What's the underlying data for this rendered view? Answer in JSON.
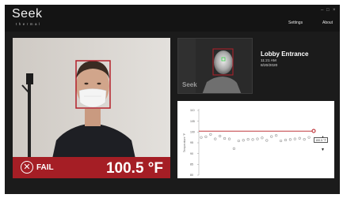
{
  "app": {
    "logo": "Seek",
    "logo_sub": "thermal"
  },
  "nav": {
    "settings": "Settings",
    "about": "About"
  },
  "window": {
    "minimize": "–",
    "maximize": "□",
    "close": "×"
  },
  "status": {
    "result": "FAIL",
    "temperature": "100.5 °F",
    "color": "#a51e25"
  },
  "location": {
    "name": "Lobby Entrance",
    "time": "11:21 AM",
    "date": "8/20/2020"
  },
  "thermal": {
    "watermark": "Seek"
  },
  "chart_data": {
    "type": "scatter",
    "ylabel": "Temperature °F",
    "ylim": [
      80,
      110
    ],
    "yticks": [
      "110",
      "105",
      "100",
      "95",
      "90",
      "85",
      "80"
    ],
    "threshold": 100.4,
    "values": [
      97.5,
      97.8,
      98.9,
      96.8,
      98.1,
      97.0,
      96.8,
      92.3,
      95.9,
      96.2,
      96.6,
      96.5,
      96.8,
      97.3,
      96.1,
      97.9,
      98.4,
      95.9,
      96.3,
      96.5,
      96.8,
      97.1,
      96.6,
      97.5,
      100.5
    ],
    "selected_index": 24,
    "tooltip": "100.5 °F",
    "threshold_color": "#c0393e",
    "point_color": "#9a9a9a"
  }
}
